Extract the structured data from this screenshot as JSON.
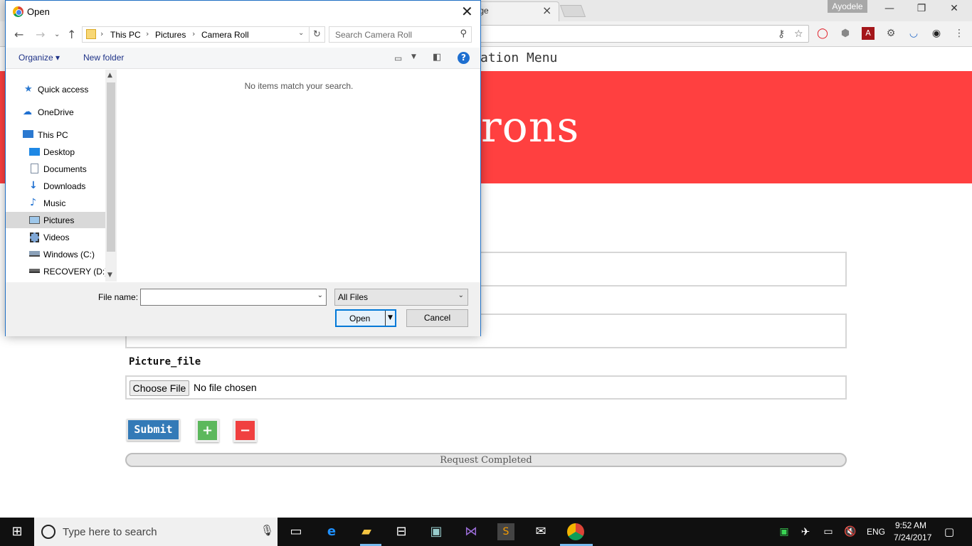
{
  "browser": {
    "tab_title": "nage",
    "tab_close": "×",
    "profile_name": "Ayodele",
    "window_controls": {
      "minimize": "—",
      "restore": "❐",
      "close": "✕"
    }
  },
  "page": {
    "nav_text": "ation Menu",
    "hero_title": "rons",
    "picture_label": "Picture_file",
    "choose_file_label": "Choose File",
    "no_file_text": "No file chosen",
    "submit_label": "Submit",
    "add_label": "+",
    "remove_label": "−",
    "progress_text": "Request Completed",
    "colors": {
      "hero": "#ff4040",
      "submit": "#337ab7",
      "add": "#5cb85c",
      "remove": "#f04040"
    }
  },
  "dialog": {
    "title": "Open",
    "breadcrumb": [
      "This PC",
      "Pictures",
      "Camera Roll"
    ],
    "search_placeholder": "Search Camera Roll",
    "toolbar": {
      "organize": "Organize ▾",
      "new_folder": "New folder"
    },
    "nav_items": [
      {
        "label": "Quick access",
        "icon": "star-icon"
      },
      {
        "label": "OneDrive",
        "icon": "cloud-icon"
      },
      {
        "label": "This PC",
        "icon": "computer-icon"
      },
      {
        "label": "Desktop",
        "icon": "desktop-icon"
      },
      {
        "label": "Documents",
        "icon": "documents-icon"
      },
      {
        "label": "Downloads",
        "icon": "download-icon"
      },
      {
        "label": "Music",
        "icon": "music-icon"
      },
      {
        "label": "Pictures",
        "icon": "pictures-icon"
      },
      {
        "label": "Videos",
        "icon": "videos-icon"
      },
      {
        "label": "Windows (C:)",
        "icon": "drive-icon"
      },
      {
        "label": "RECOVERY (D:)",
        "icon": "drive-icon"
      }
    ],
    "selected_nav": "Pictures",
    "empty_message": "No items match your search.",
    "file_name_label": "File name:",
    "file_name_value": "",
    "filter_value": "All Files",
    "open_label": "Open",
    "cancel_label": "Cancel"
  },
  "taskbar": {
    "search_placeholder": "Type here to search",
    "language": "ENG",
    "time": "9:52 AM",
    "date": "7/24/2017"
  }
}
